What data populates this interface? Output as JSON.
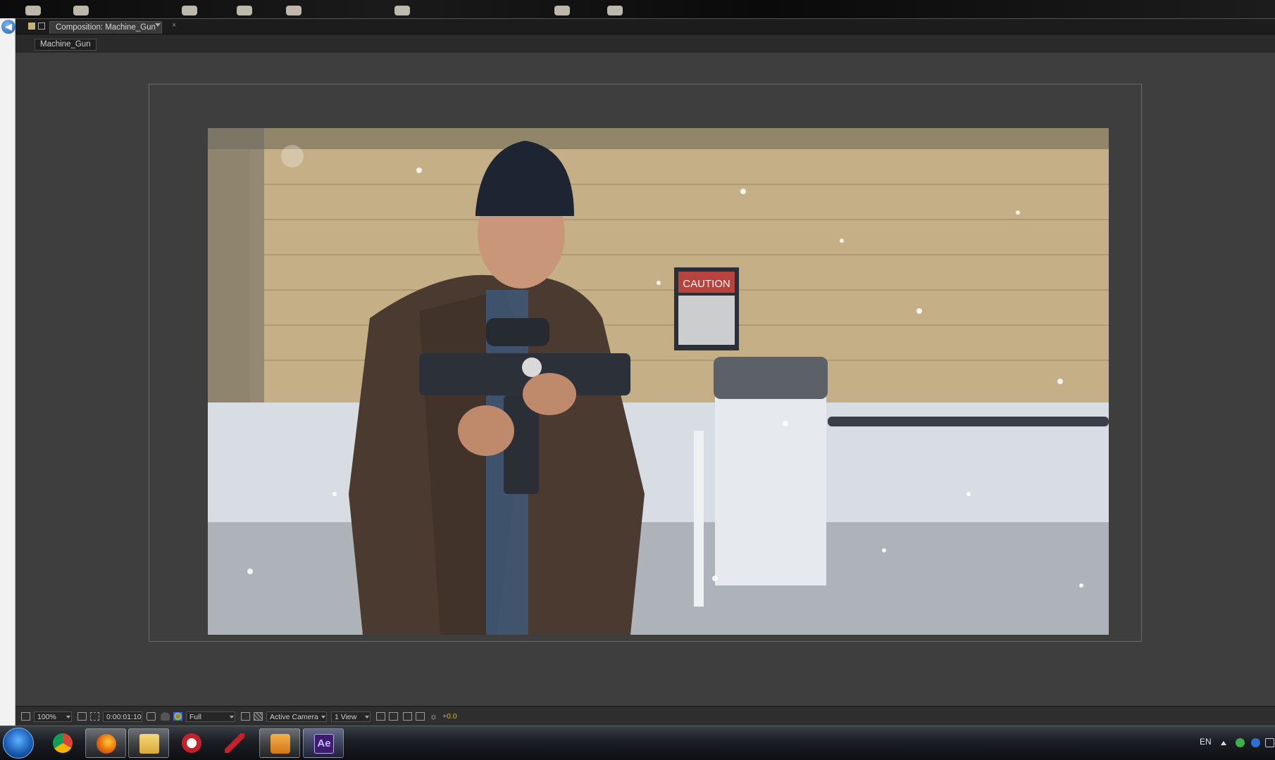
{
  "window": {
    "tab_title": "Composition: Machine_Gun",
    "comp_name": "Machine_Gun"
  },
  "toolbar": {
    "zoom": "100%",
    "timecode": "0:00:01:10",
    "resolution": "Full",
    "camera": "Active Camera",
    "views": "1 View",
    "exposure": "+0.0"
  },
  "footage": {
    "sign_text": "CAUTION"
  },
  "taskbar": {
    "apps": [
      "chrome-icon",
      "firefox-icon",
      "explorer-icon",
      "ccleaner-icon",
      "sound-app-icon",
      "media-player-icon",
      "after-effects-icon"
    ],
    "ae_label": "Ae",
    "tray_lang": "EN"
  },
  "colors": {
    "panel_bg": "#3e3e3e",
    "exposure_accent": "#e0b63a",
    "ae_purple": "#3d1e6e"
  }
}
